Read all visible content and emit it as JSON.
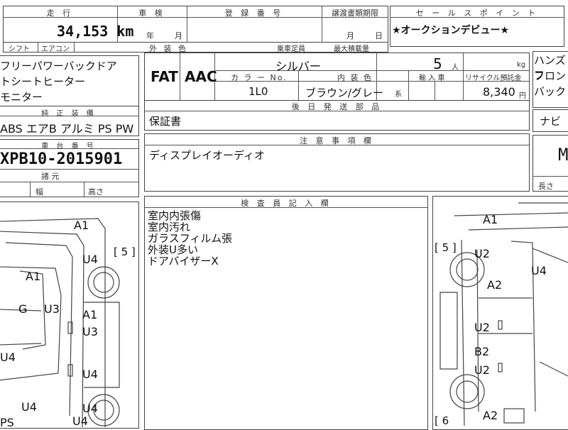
{
  "top": {
    "headers": [
      "走 行",
      "車 検",
      "登 録 番 号",
      "譲渡書類期限",
      "セ ー ル ス ポ イ ン ト"
    ],
    "mileage": "34,153 km",
    "shaken_year": "年",
    "shaken_month": "月",
    "deadline_month": "月",
    "deadline_day": "日",
    "sales_point": "★オークションデビュー★",
    "row2_labels": [
      "シフト",
      "エアコン",
      "外 装 色",
      "乗車定員",
      "最大積載量"
    ]
  },
  "left_panel": {
    "equipment": [
      "フリーパワーバックドア",
      "トシートヒーター",
      "モニター"
    ],
    "genuine_header": "純 正 装 備",
    "genuine_items": "ABS エアB アルミ PS PW",
    "chassis_header": "車 台 番 号",
    "chassis_no": "XPB10-2015901",
    "dims": [
      "諸 元",
      "幅",
      "高さ"
    ]
  },
  "spec": {
    "shift": "FAT",
    "aircon": "AAC",
    "color_name": "シルバー",
    "color_no_label": "カ ラ ー No.",
    "color_no": "1L0",
    "interior_label": "内 装 色",
    "interior": "ブラウン/グレー",
    "interior_suffix": "系",
    "capacity": "5",
    "capacity_unit": "人",
    "kg": "kg",
    "import_label": "輸 入 車",
    "recycle_label": "リサイクル預託金",
    "recycle_amount": "8,340",
    "yen": "円",
    "later_parts_header": "後 日 発 送 部 品",
    "later_parts": "保証書",
    "notes_header": "注 意 事 項 欄",
    "notes": "ディスプレイオーディオ"
  },
  "inspector": {
    "header": "検 査 員 記 入 欄",
    "lines": [
      "室内内張傷",
      "室内汚れ",
      "ガラスフィルム張",
      "外装U多い",
      "ドアバイザーX"
    ]
  },
  "right_panel": {
    "lines": [
      "ハンズフ",
      "フロン",
      "バック"
    ],
    "navi": "ナビ",
    "big_letter": "M",
    "length": "長さ"
  },
  "left_diagram": {
    "seats": "[ 5 ]",
    "codes": [
      "A1",
      "U4",
      "A1",
      "G",
      "U3",
      "A1",
      "U3",
      "U4",
      "U4",
      "U4",
      "U4",
      "U4",
      "PS"
    ]
  },
  "right_diagram": {
    "seats": "[ 5 ]",
    "seats_bottom": "[ 6",
    "codes": [
      "A1",
      "U2",
      "U4",
      "A2",
      "U2",
      "B2",
      "U2",
      "A2"
    ]
  }
}
